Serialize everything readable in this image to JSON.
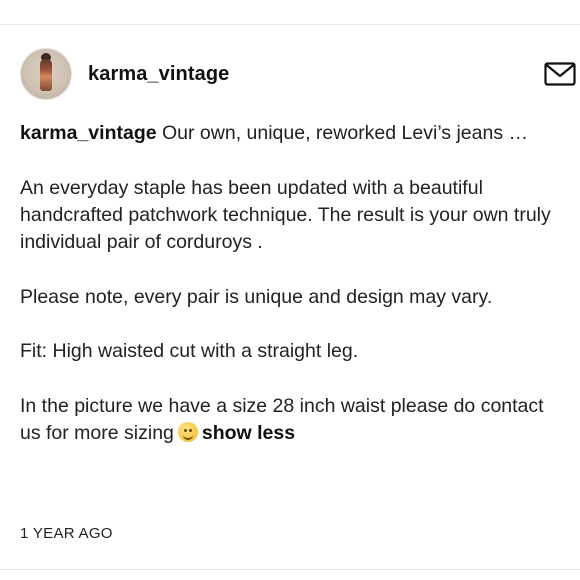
{
  "post": {
    "username": "karma_vintage",
    "caption_lead": "Our own, unique, reworked Levi’s jeans …",
    "paragraphs": [
      "An everyday staple has been updated with a beautiful handcrafted patchwork technique. The result is your own truly individual pair of corduroys .",
      "Please note, every pair is unique and design may vary.",
      "Fit: High waisted cut with a straight  leg."
    ],
    "last_paragraph": "In the picture we have a size 28 inch waist please do  contact us  for more sizing",
    "show_less_label": "show less",
    "timestamp": "1 YEAR AGO"
  },
  "icons": {
    "header_action": "mail-icon",
    "emoji": "smiling-face-emoji"
  }
}
